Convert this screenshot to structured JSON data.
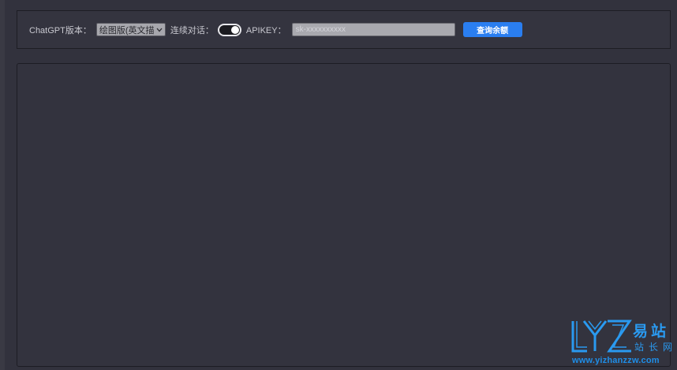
{
  "toolbar": {
    "version_label": "ChatGPT版本：",
    "version_selected": "绘图版(英文描",
    "continuous_label": "连续对话：",
    "continuous_on": true,
    "apikey_label": "APIKEY：",
    "apikey_placeholder": "sk-xxxxxxxxxx",
    "apikey_value": "",
    "query_button": "查询余额"
  },
  "watermark": {
    "logo_letters": "YZ",
    "cn_top": "易站",
    "cn_bottom": "站长网",
    "url": "www.yizhanzzw.com"
  },
  "colors": {
    "background": "#32323d",
    "accent": "#2a7ef0",
    "watermark": "#1e8ee8"
  }
}
